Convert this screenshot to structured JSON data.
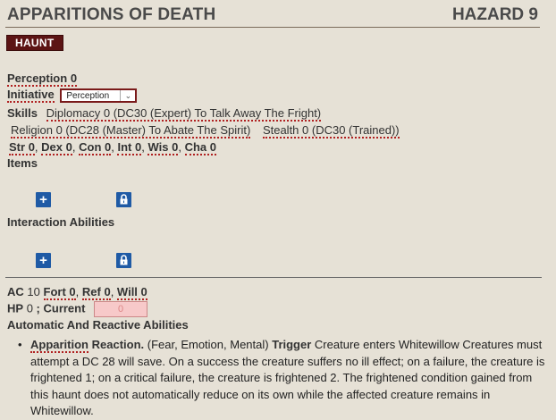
{
  "header": {
    "title": "APPARITIONS OF DEATH",
    "hazard": "HAZARD 9",
    "trait": "HAUNT"
  },
  "perception": {
    "label": "Perception",
    "value": "0"
  },
  "initiative": {
    "label": "Initiative",
    "selected": "Perception"
  },
  "skills": {
    "label": "Skills",
    "items": [
      "Diplomacy 0 (DC30 (Expert) To Talk Away The Fright)",
      "Religion 0 (DC28 (Master) To Abate The Spirit)",
      "Stealth 0 (DC30 (Trained))"
    ]
  },
  "abilities": [
    {
      "label": "Str",
      "value": "0"
    },
    {
      "label": "Dex",
      "value": "0"
    },
    {
      "label": "Con",
      "value": "0"
    },
    {
      "label": "Int",
      "value": "0"
    },
    {
      "label": "Wis",
      "value": "0"
    },
    {
      "label": "Cha",
      "value": "0"
    }
  ],
  "sections": {
    "items": "Items",
    "interaction": "Interaction Abilities",
    "automatic": "Automatic And Reactive Abilities"
  },
  "defense": {
    "ac_label": "AC",
    "ac_value": "10",
    "fort_label": "Fort",
    "fort_value": "0",
    "ref_label": "Ref",
    "ref_value": "0",
    "will_label": "Will",
    "will_value": "0",
    "hp_label": "HP",
    "hp_value": "0",
    "current_label": "; Current",
    "current_value": "0"
  },
  "ability": {
    "name": "Apparition",
    "type": "Reaction.",
    "traits": "(Fear, Emotion, Mental)",
    "trigger_label": "Trigger",
    "text": "Creature enters Whitewillow Creatures must attempt a DC 28 will save. On a success the creature suffers no ill effect; on a failure, the creature is frightened 1; on a critical failure, the creature is frightened 2. The frightened condition gained from this haunt does not automatically reduce on its own while the affected creature remains in Whitewillow."
  },
  "colors": {
    "background": "#e6e1d6",
    "trait_badge": "#5c1414",
    "button_blue": "#1f5aa5",
    "current_field": "#f7c9c9"
  }
}
